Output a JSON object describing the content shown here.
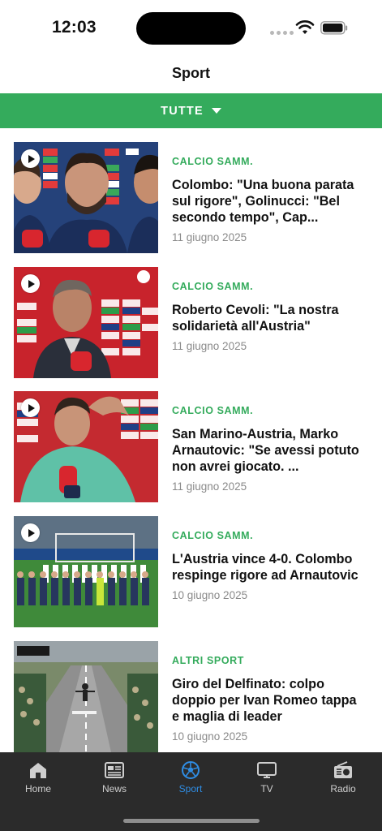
{
  "status_bar": {
    "time": "12:03"
  },
  "header": {
    "title": "Sport"
  },
  "filter": {
    "label": "TUTTE"
  },
  "news": [
    {
      "category": "CALCIO SAMM.",
      "headline": "Colombo: \"Una buona parata sul rigore\", Golinucci: \"Bel secondo tempo\", Cap...",
      "date": "11 giugno 2025",
      "has_video": true
    },
    {
      "category": "CALCIO SAMM.",
      "headline": "Roberto Cevoli: \"La nostra solidarietà all'Austria\"",
      "date": "11 giugno 2025",
      "has_video": true
    },
    {
      "category": "CALCIO SAMM.",
      "headline": "San Marino-Austria, Marko Arnautovic: \"Se avessi potuto non avrei giocato. ...",
      "date": "11 giugno 2025",
      "has_video": true
    },
    {
      "category": "CALCIO SAMM.",
      "headline": "L'Austria vince 4-0. Colombo respinge rigore ad Arnautovic",
      "date": "10 giugno 2025",
      "has_video": true
    },
    {
      "category": "ALTRI SPORT",
      "headline": "Giro del Delfinato: colpo doppio per Ivan Romeo tappa e maglia di leader",
      "date": "10 giugno 2025",
      "has_video": false
    }
  ],
  "tabs": [
    {
      "label": "Home",
      "icon": "home-icon",
      "active": false
    },
    {
      "label": "News",
      "icon": "newspaper-icon",
      "active": false
    },
    {
      "label": "Sport",
      "icon": "soccer-ball-icon",
      "active": true
    },
    {
      "label": "TV",
      "icon": "tv-icon",
      "active": false
    },
    {
      "label": "Radio",
      "icon": "radio-icon",
      "active": false
    }
  ],
  "colors": {
    "accent_green": "#34ab5c",
    "active_tab_blue": "#2f8de4",
    "tab_bar_bg": "#2b2b2b"
  }
}
